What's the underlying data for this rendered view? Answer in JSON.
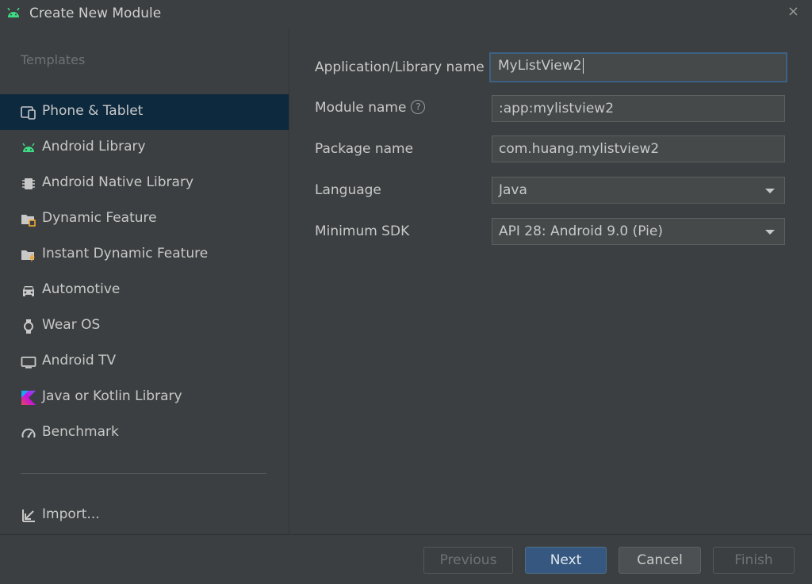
{
  "window": {
    "title": "Create New Module",
    "icon": "android-icon",
    "close_glyph": "×"
  },
  "sidebar": {
    "heading": "Templates",
    "items": [
      {
        "label": "Phone & Tablet",
        "icon": "phone-tablet-icon",
        "selected": true
      },
      {
        "label": "Android Library",
        "icon": "android-icon"
      },
      {
        "label": "Android Native Library",
        "icon": "native-library-icon"
      },
      {
        "label": "Dynamic Feature",
        "icon": "dynamic-feature-icon"
      },
      {
        "label": "Instant Dynamic Feature",
        "icon": "instant-dynamic-feature-icon"
      },
      {
        "label": "Automotive",
        "icon": "car-icon"
      },
      {
        "label": "Wear OS",
        "icon": "watch-icon"
      },
      {
        "label": "Android TV",
        "icon": "tv-icon"
      },
      {
        "label": "Java or Kotlin Library",
        "icon": "kotlin-icon"
      },
      {
        "label": "Benchmark",
        "icon": "gauge-icon"
      }
    ],
    "import_label": "Import..."
  },
  "form": {
    "app_name_label": "Application/Library name",
    "app_name_value": "MyListView2",
    "module_name_label": "Module name",
    "module_name_value": ":app:mylistview2",
    "package_name_label": "Package name",
    "package_name_value": "com.huang.mylistview2",
    "language_label": "Language",
    "language_value": "Java",
    "min_sdk_label": "Minimum SDK",
    "min_sdk_value": "API 28: Android 9.0 (Pie)"
  },
  "footer": {
    "previous": "Previous",
    "next": "Next",
    "cancel": "Cancel",
    "finish": "Finish"
  },
  "colors": {
    "background": "#3c3f41",
    "selection": "#0d293e",
    "primary_button": "#365880",
    "android_green": "#3ddc84"
  }
}
